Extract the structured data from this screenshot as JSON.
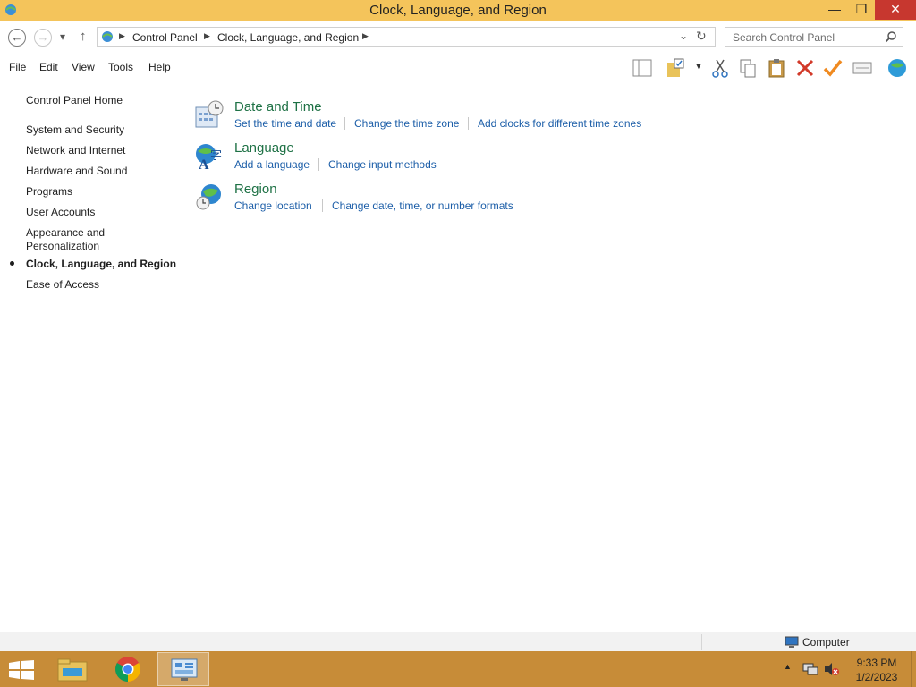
{
  "window": {
    "title": "Clock, Language, and Region"
  },
  "window_controls": {
    "minimize": "—",
    "maximize": "❐",
    "close": "✕"
  },
  "nav": {
    "back_icon": "back-arrow-icon",
    "forward_icon": "forward-arrow-icon",
    "up_icon": "up-arrow-icon",
    "breadcrumb": [
      "Control Panel",
      "Clock, Language, and Region"
    ],
    "search_placeholder": "Search Control Panel"
  },
  "menu": [
    "File",
    "Edit",
    "View",
    "Tools",
    "Help"
  ],
  "sidebar": {
    "home": "Control Panel Home",
    "items": [
      "System and Security",
      "Network and Internet",
      "Hardware and Sound",
      "Programs",
      "User Accounts",
      "Appearance and Personalization",
      "Clock, Language, and Region",
      "Ease of Access"
    ],
    "current": "Clock, Language, and Region"
  },
  "categories": [
    {
      "title": "Date and Time",
      "icon": "date-time-icon",
      "links": [
        "Set the time and date",
        "Change the time zone",
        "Add clocks for different time zones"
      ]
    },
    {
      "title": "Language",
      "icon": "language-icon",
      "links": [
        "Add a language",
        "Change input methods"
      ]
    },
    {
      "title": "Region",
      "icon": "region-globe-icon",
      "links": [
        "Change location",
        "Change date, time, or number formats"
      ]
    }
  ],
  "statusbar": {
    "label": "Computer"
  },
  "taskbar": {
    "time": "9:33 PM",
    "date": "1/2/2023"
  },
  "colors": {
    "titlebar": "#f4c45b",
    "taskbar": "#c78c38",
    "category_title": "#1e7145",
    "link": "#1c5ea8"
  }
}
